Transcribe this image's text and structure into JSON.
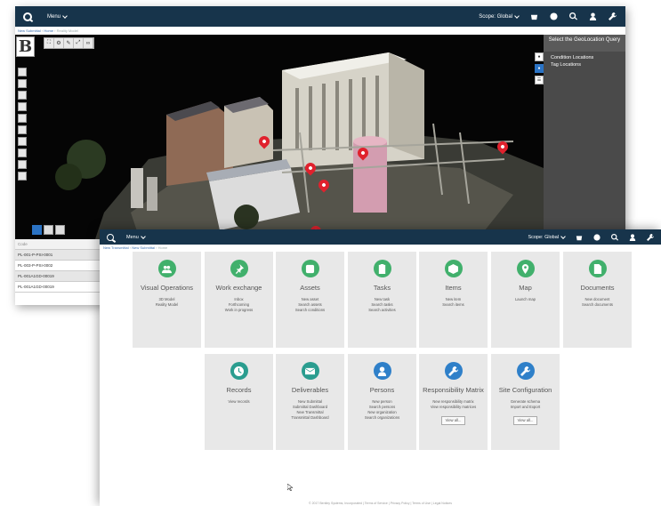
{
  "back_window": {
    "menu_label": "Menu",
    "scope_label": "Scope: Global",
    "breadcrumb": [
      "New Submittal",
      "Home",
      "Reality Model"
    ],
    "side_panel": {
      "title": "Select the GeoLocation Query",
      "items": [
        "Condition Locations",
        "Tag Locations"
      ]
    },
    "code_table": {
      "header": "Code",
      "rows": [
        "PL-001-P-PSI-0001",
        "PL-003-P-PSI-0002",
        "PL-001A1GD-00019",
        "PL-001A1GD-00019"
      ]
    }
  },
  "front_window": {
    "menu_label": "Menu",
    "scope_label": "Scope: Global",
    "breadcrumb": [
      "New Transmittal",
      "New Submittal",
      "Home"
    ],
    "tiles": [
      {
        "name": "Visual Operations",
        "icon": "users-icon",
        "links": [
          "3D Model",
          "Reality Model"
        ]
      },
      {
        "name": "Work exchange",
        "icon": "pin-icon",
        "links": [
          "Inbox",
          "Forthcoming",
          "Work in progress"
        ]
      },
      {
        "name": "Assets",
        "icon": "box-icon",
        "links": [
          "New asset",
          "Search assets",
          "Search conditions"
        ]
      },
      {
        "name": "Tasks",
        "icon": "clipboard-icon",
        "links": [
          "New task",
          "Search tasks",
          "Search activities"
        ]
      },
      {
        "name": "Items",
        "icon": "cube-icon",
        "links": [
          "New item",
          "Search items"
        ]
      },
      {
        "name": "Map",
        "icon": "location-icon",
        "links": [
          "Launch map"
        ]
      },
      {
        "name": "Documents",
        "icon": "document-icon",
        "links": [
          "New document",
          "Search documents"
        ]
      },
      {
        "name": "Records",
        "icon": "clock-icon",
        "links": [
          "View records"
        ]
      },
      {
        "name": "Deliverables",
        "icon": "envelope-icon",
        "links": [
          "New Submittal",
          "Submittal Dashboard",
          "New Transmittal",
          "Transmittal Dashboard"
        ]
      },
      {
        "name": "Persons",
        "icon": "person-icon",
        "links": [
          "New person",
          "Search persons",
          "New organization",
          "Search organizations"
        ]
      },
      {
        "name": "Responsibility Matrix",
        "icon": "wrench-icon",
        "links": [
          "New responsibility matrix",
          "View responsibility matrices"
        ],
        "button": "View all..."
      },
      {
        "name": "Site Configuration",
        "icon": "wrench-icon",
        "links": [
          "Generate schema",
          "Import and Export"
        ],
        "button": "View all..."
      }
    ],
    "footer": "© 2017 Bentley Systems, Incorporated | Terms of Service | Privacy Policy | Terms of Use | Legal Notices"
  },
  "colors": {
    "topbar": "#17344b",
    "accent_green": "#41b06c",
    "accent_blue": "#2f80c9",
    "tile_bg": "#e8e8e8"
  }
}
